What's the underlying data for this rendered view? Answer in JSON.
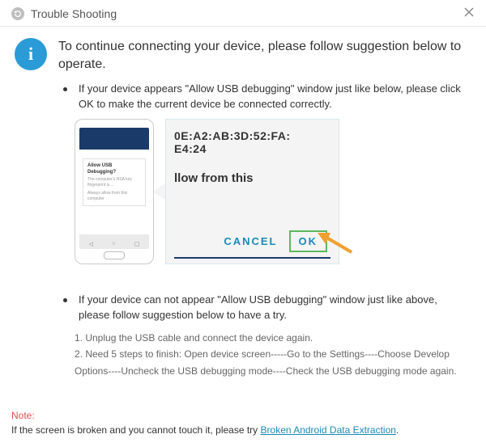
{
  "titlebar": {
    "title": "Trouble Shooting"
  },
  "heading": "To continue connecting your device, please follow suggestion below to operate.",
  "suggestion1": "If your device appears \"Allow USB debugging\" window just like below, please click OK to make the current device  be connected correctly.",
  "dialog": {
    "mac1": "0E:A2:AB:3D:52:FA:",
    "mac2": "E4:24",
    "allow": "llow from this",
    "cancel": "CANCEL",
    "ok": "OK",
    "sm_title": "Allow USB Debugging?",
    "sm_body": "The computer's RSA key fingerprint is ...",
    "sm_always": "Always allow from this computer"
  },
  "nav": {
    "a": "◁",
    "b": "○",
    "c": "▢"
  },
  "suggestion2": "If your device can not appear \"Allow USB debugging\" window just like above, please follow suggestion below to have a try.",
  "step1": "1. Unplug the USB cable and connect the device again.",
  "step2": "2. Need 5 steps to finish: Open device screen-----Go to the Settings----Choose Develop Options----Uncheck the USB debugging mode----Check the USB debugging mode again.",
  "note": {
    "label": "Note:",
    "text": "If the screen is broken and you cannot touch it, please try ",
    "link": "Broken Android Data Extraction",
    "suffix": "."
  }
}
